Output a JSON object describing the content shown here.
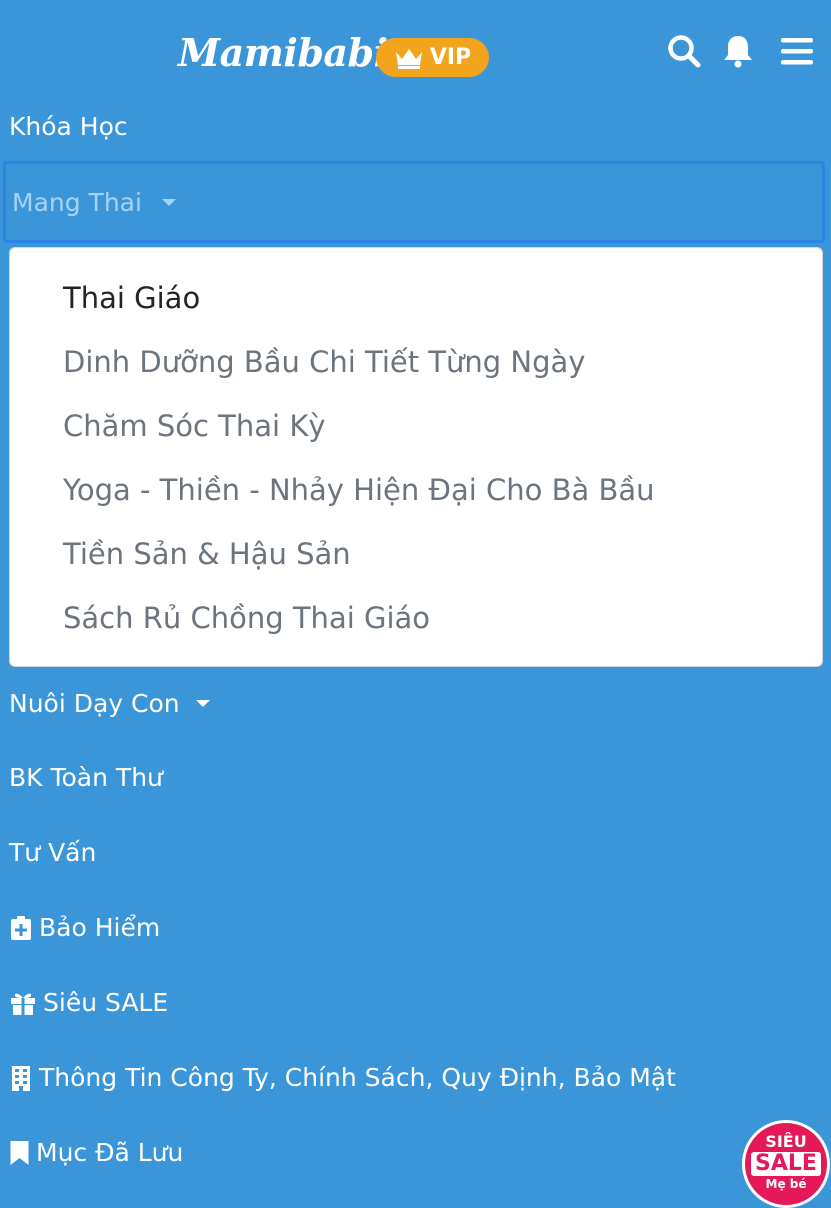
{
  "header": {
    "logo_text": "Mamibabi",
    "vip_label": "VIP",
    "icons": [
      "search-icon",
      "bell-icon",
      "menu-icon"
    ]
  },
  "nav": {
    "courses": "Khóa Học",
    "pregnancy": "Mang Thai",
    "pregnancy_menu": [
      "Thai Giáo",
      "Dinh Dưỡng Bầu Chi Tiết Từng Ngày",
      "Chăm Sóc Thai Kỳ",
      "Yoga - Thiền - Nhảy Hiện Đại Cho Bà Bầu",
      "Tiền Sản & Hậu Sản",
      "Sách Rủ Chồng Thai Giáo"
    ],
    "parenting": "Nuôi Dạy Con",
    "encyclopedia": "BK Toàn Thư",
    "consulting": "Tư Vấn",
    "insurance": "Bảo Hiểm",
    "super_sale": "Siêu SALE",
    "company_info": "Thông Tin Công Ty, Chính Sách, Quy Định, Bảo Mật",
    "saved": "Mục Đã Lưu"
  },
  "sale_badge": {
    "line1": "SIÊU",
    "line2": "SALE",
    "line3": "Mẹ bé"
  },
  "colors": {
    "background": "#3b96d9",
    "vip": "#f2a51c",
    "sale": "#e5195a",
    "focus_border": "#2c84e6"
  }
}
